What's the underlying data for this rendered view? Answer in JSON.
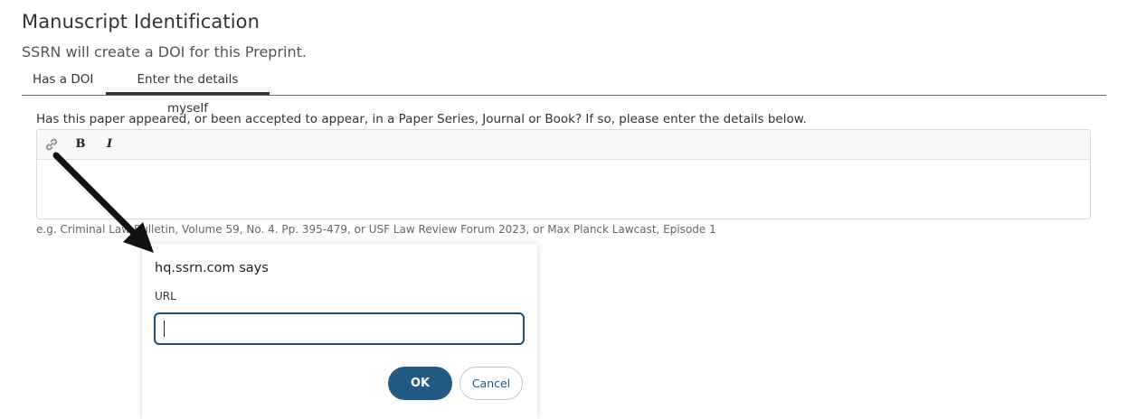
{
  "header": {
    "title": "Manuscript Identification",
    "subtitle": "SSRN will create a DOI for this Preprint."
  },
  "tabs": [
    {
      "label": "Has a DOI",
      "active": false
    },
    {
      "label": "Enter the details myself",
      "active": true
    }
  ],
  "form": {
    "question": "Has this paper appeared, or been accepted to appear, in a Paper Series, Journal or Book? If so, please enter the details below.",
    "toolbar": {
      "link_icon": "link-icon",
      "bold_label": "B",
      "italic_label": "I"
    },
    "example": "e.g. Criminal Law Bulletin, Volume 59, No. 4. Pp. 395-479, or USF Law Review Forum 2023, or Max Planck Lawcast, Episode 1"
  },
  "dialog": {
    "title": "hq.ssrn.com says",
    "label": "URL",
    "input_value": "",
    "ok_label": "OK",
    "cancel_label": "Cancel"
  },
  "colors": {
    "primary_button": "#235a83",
    "input_border": "#1f4e75",
    "arrow": "#111111"
  }
}
